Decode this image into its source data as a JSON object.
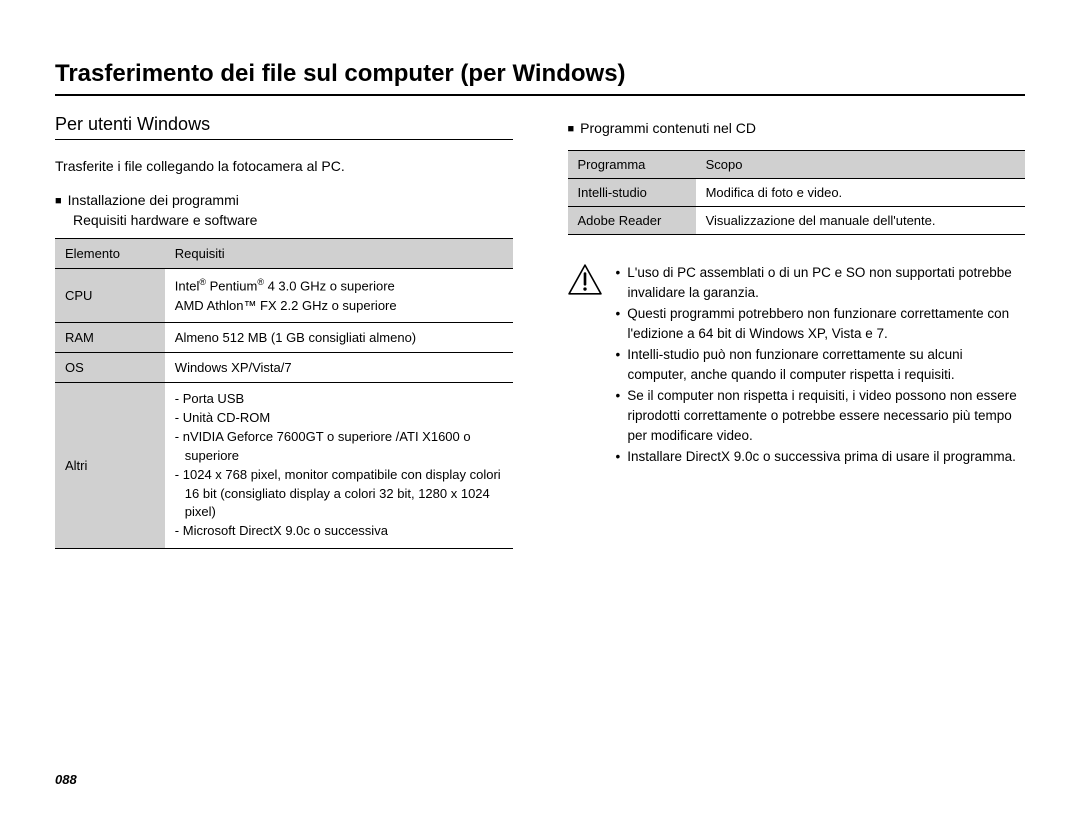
{
  "title": "Trasferimento dei file sul computer (per Windows)",
  "subhead": "Per utenti Windows",
  "intro": "Trasferite i file collegando la fotocamera al PC.",
  "install": {
    "head": "Installazione dei programmi",
    "sub": "Requisiti hardware e software"
  },
  "reqTable": {
    "headers": {
      "c1": "Elemento",
      "c2": "Requisiti"
    },
    "rows": {
      "cpu": {
        "label": "CPU",
        "line1_a": "Intel",
        "line1_b": " Pentium",
        "line1_c": " 4 3.0 GHz o superiore",
        "line2": "AMD Athlon™ FX 2.2 GHz o superiore"
      },
      "ram": {
        "label": "RAM",
        "value": "Almeno 512 MB (1 GB consigliati almeno)"
      },
      "os": {
        "label": "OS",
        "value": "Windows XP/Vista/7"
      },
      "other": {
        "label": "Altri",
        "items": [
          "Porta USB",
          "Unità CD-ROM",
          "nVIDIA Geforce 7600GT o superiore /ATI X1600 o superiore",
          "1024 x 768 pixel, monitor compatibile con display colori 16 bit (consigliato display a colori 32 bit, 1280 x 1024 pixel)",
          "Microsoft DirectX 9.0c o successiva"
        ]
      }
    }
  },
  "programs": {
    "head": "Programmi contenuti nel CD",
    "headers": {
      "c1": "Programma",
      "c2": "Scopo"
    },
    "rows": [
      {
        "name": "Intelli-studio",
        "desc": "Modifica di foto e video."
      },
      {
        "name": "Adobe Reader",
        "desc": "Visualizzazione del manuale dell'utente."
      }
    ]
  },
  "warn": [
    "L'uso di PC assemblati o di un PC e SO non supportati potrebbe invalidare la garanzia.",
    "Questi programmi potrebbero non funzionare correttamente con l'edizione a 64 bit di Windows XP, Vista e 7.",
    "Intelli-studio può non funzionare correttamente su alcuni computer, anche quando il computer rispetta i requisiti.",
    "Se il computer non rispetta i requisiti, i video possono non essere riprodotti correttamente o potrebbe essere necessario più tempo per modificare video.",
    "Installare DirectX 9.0c o successiva prima di usare il programma."
  ],
  "pageNum": "088"
}
